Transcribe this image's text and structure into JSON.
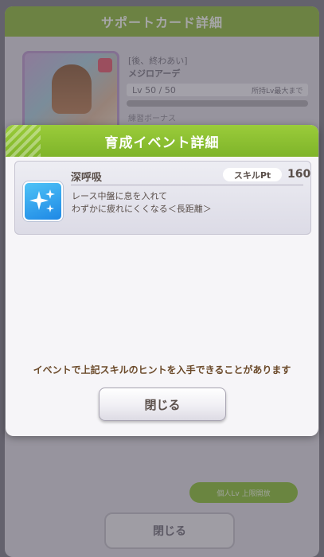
{
  "background": {
    "title": "サポートカード詳細",
    "card_name_line1": "[後、終わあい]",
    "card_name_line2": "メジロアーデ",
    "level": "Lv 50 / 50",
    "level_note": "所持Lv最大まで",
    "bonus_label": "練習ボーナス",
    "green_button": "個人Lv  上限開放",
    "close_label": "閉じる"
  },
  "dialog": {
    "title": "育成イベント詳細",
    "skill": {
      "name": "深呼吸",
      "pt_label": "スキルPt",
      "pt_value": "160",
      "desc_line1": "レース中盤に息を入れて",
      "desc_line2": "わずかに疲れにくくなる＜長距離＞",
      "icon": "sparkle-icon"
    },
    "note": "イベントで上記スキルのヒントを入手できることがあります",
    "close_label": "閉じる"
  },
  "colors": {
    "header_green": "#8ac232",
    "text_brown": "#5a4f4a",
    "note_brown": "#6b4a2a",
    "skill_icon_blue": "#2a95ee"
  }
}
